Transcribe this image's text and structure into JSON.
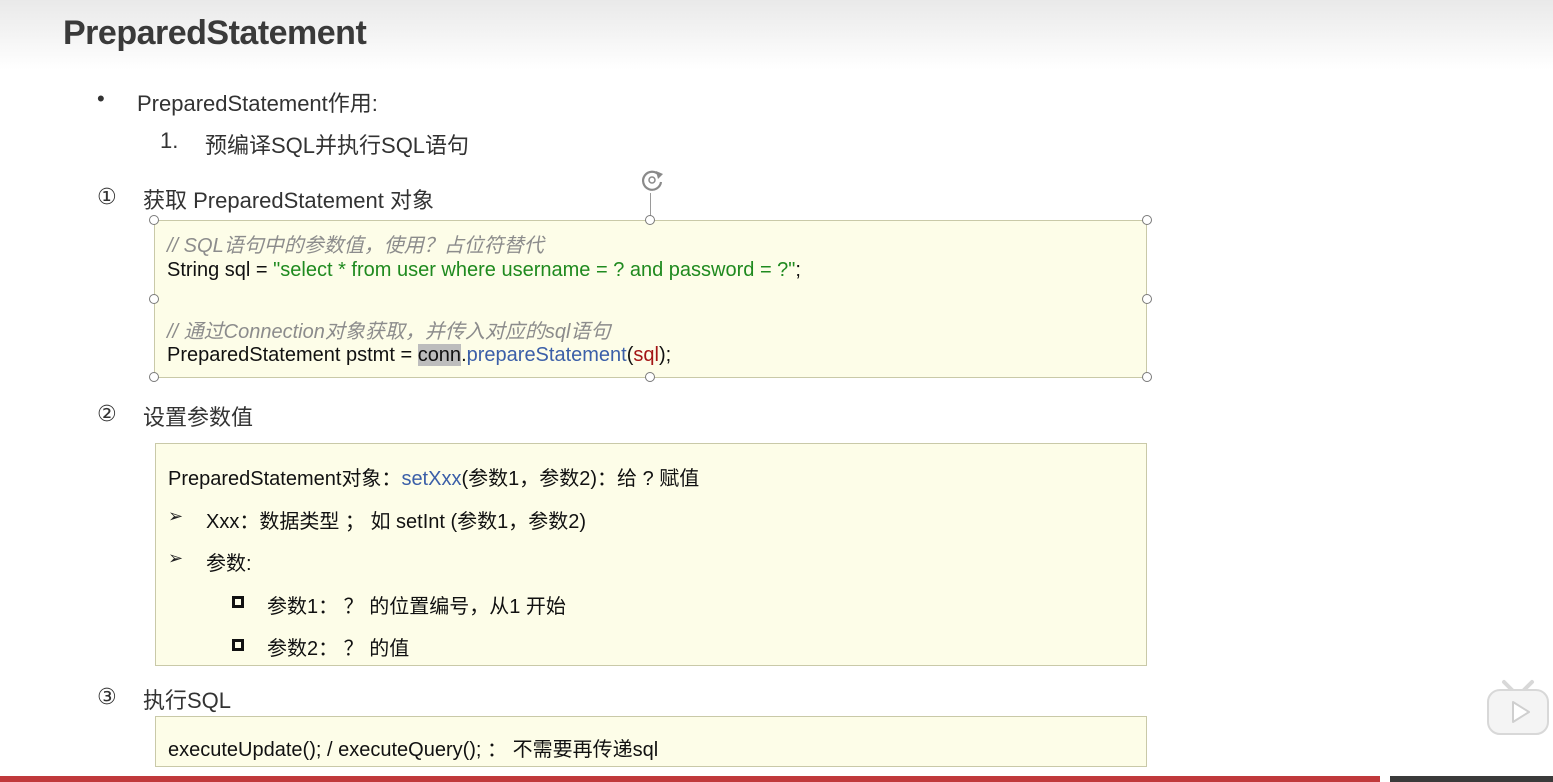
{
  "slide": {
    "title": "PreparedStatement",
    "bullet_text": "PreparedStatement作用:",
    "numbered_item_num": "1.",
    "numbered_item_text": "预编译SQL并执行SQL语句"
  },
  "step1": {
    "num": "①",
    "heading": "获取 PreparedStatement 对象",
    "comment1": "// SQL语句中的参数值，使用？占位符替代",
    "line1_prefix": "String sql = ",
    "line1_string": "\"select * from user where username = ? and password = ?\"",
    "line1_suffix": ";",
    "comment2": "// 通过Connection对象获取，并传入对应的sql语句",
    "line2_prefix": "PreparedStatement pstmt = ",
    "line2_conn": "conn",
    "line2_dot": ".",
    "line2_method": "prepareStatement",
    "line2_open": "(",
    "line2_param": "sql",
    "line2_close": ");"
  },
  "step2": {
    "num": "②",
    "heading": "设置参数值",
    "line1_prefix": "PreparedStatement对象：",
    "line1_method": "setXxx",
    "line1_suffix": "(参数1，参数2)：给 ? 赋值",
    "arrow": "➢",
    "item1": "Xxx：数据类型 ； 如 setInt (参数1，参数2)",
    "item2": "参数:",
    "sub1": "参数1： ？ 的位置编号，从1 开始",
    "sub2": "参数2： ？ 的值"
  },
  "step3": {
    "num": "③",
    "heading": "执行SQL",
    "text": "executeUpdate(); / executeQuery(); ： 不需要再传递sql"
  },
  "icons": {
    "rotate": "rotate-handle-icon",
    "player": "bilibili-tv-icon"
  },
  "colors": {
    "box_bg": "#fdfde8",
    "comment": "#8c8c8c",
    "string": "#1f8a1f",
    "method": "#3b5fa8",
    "param": "#a31515",
    "bottom_bar": "#c0393b"
  }
}
